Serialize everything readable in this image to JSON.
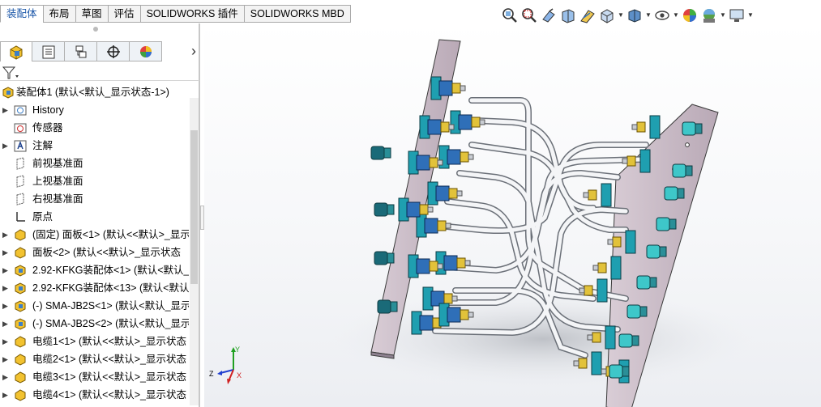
{
  "tabs": [
    "装配体",
    "布局",
    "草图",
    "评估",
    "SOLIDWORKS 插件",
    "SOLIDWORKS MBD"
  ],
  "active_tab": "装配体",
  "panel": {
    "collapse_arrow": "›",
    "tabs": [
      {
        "icon": "feature-manager-icon"
      },
      {
        "icon": "property-manager-icon"
      },
      {
        "icon": "configuration-manager-icon"
      },
      {
        "icon": "dimxpert-icon"
      },
      {
        "icon": "display-manager-icon"
      }
    ]
  },
  "tree": {
    "root": "装配体1  (默认<默认_显示状态-1>)",
    "items": [
      {
        "label": "History",
        "icon": "history-icon",
        "expand": "▶"
      },
      {
        "label": "传感器",
        "icon": "sensor-icon",
        "expand": ""
      },
      {
        "label": "注解",
        "icon": "annotation-icon",
        "expand": "▶"
      },
      {
        "label": "前视基准面",
        "icon": "plane-icon",
        "expand": ""
      },
      {
        "label": "上视基准面",
        "icon": "plane-icon",
        "expand": ""
      },
      {
        "label": "右视基准面",
        "icon": "plane-icon",
        "expand": ""
      },
      {
        "label": "原点",
        "icon": "origin-icon",
        "expand": ""
      },
      {
        "label": "(固定) 面板<1> (默认<<默认>_显示",
        "icon": "part-icon",
        "expand": "▶"
      },
      {
        "label": "面板<2> (默认<<默认>_显示状态",
        "icon": "part-icon",
        "expand": "▶"
      },
      {
        "label": "2.92-KFKG装配体<1> (默认<默认_",
        "icon": "subassembly-icon",
        "expand": "▶"
      },
      {
        "label": "2.92-KFKG装配体<13> (默认<默认",
        "icon": "subassembly-icon",
        "expand": "▶"
      },
      {
        "label": "(-) SMA-JB2S<1> (默认<默认_显示",
        "icon": "subassembly-icon",
        "expand": "▶"
      },
      {
        "label": "(-) SMA-JB2S<2> (默认<默认_显示",
        "icon": "subassembly-icon",
        "expand": "▶"
      },
      {
        "label": "电缆1<1> (默认<<默认>_显示状态",
        "icon": "part-icon",
        "expand": "▶"
      },
      {
        "label": "电缆2<1> (默认<<默认>_显示状态",
        "icon": "part-icon",
        "expand": "▶"
      },
      {
        "label": "电缆3<1> (默认<<默认>_显示状态",
        "icon": "part-icon",
        "expand": "▶"
      },
      {
        "label": "电缆4<1> (默认<<默认>_显示状态",
        "icon": "part-icon",
        "expand": "▶"
      }
    ]
  },
  "triad": {
    "z": "Z",
    "x": "X",
    "y": "Y"
  },
  "hud_icons": [
    "zoom-to-fit-icon",
    "zoom-area-icon",
    "previous-view-icon",
    "section-view-icon",
    "dynamic-annotation-icon",
    "view-orientation-icon",
    "display-style-icon",
    "hide-show-icon",
    "edit-appearance-icon",
    "apply-scene-icon",
    "view-settings-icon"
  ]
}
